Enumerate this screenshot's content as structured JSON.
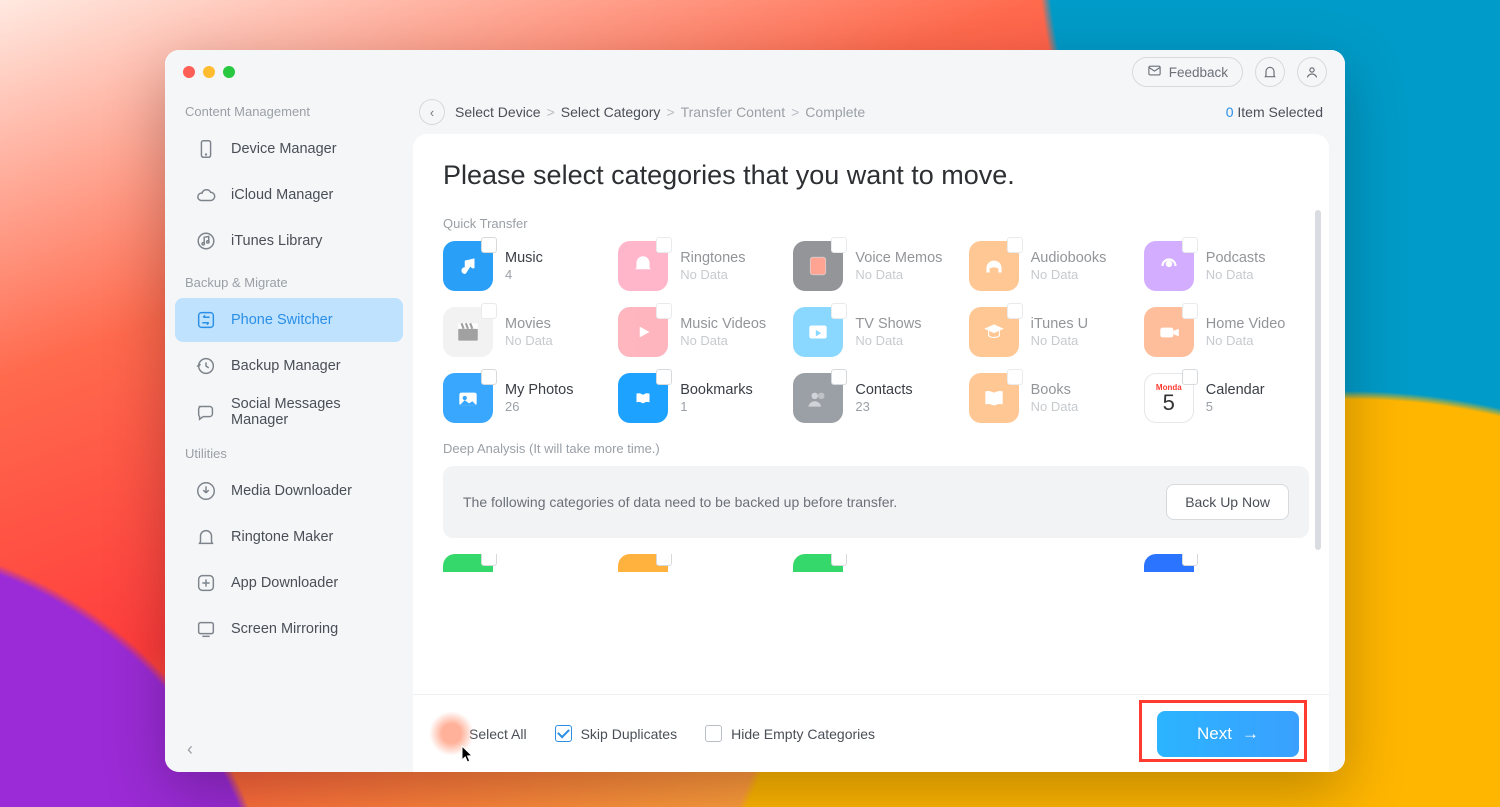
{
  "header": {
    "feedback_label": "Feedback",
    "selected_count": 0,
    "selected_label": "Item Selected"
  },
  "breadcrumb": {
    "items": [
      {
        "label": "Select Device",
        "active": true
      },
      {
        "label": "Select Category",
        "active": true
      },
      {
        "label": "Transfer Content",
        "active": false
      },
      {
        "label": "Complete",
        "active": false
      }
    ]
  },
  "sidebar": {
    "sections": [
      {
        "label": "Content Management",
        "items": [
          {
            "id": "device-manager",
            "label": "Device Manager",
            "icon": "phone"
          },
          {
            "id": "icloud-manager",
            "label": "iCloud Manager",
            "icon": "cloud"
          },
          {
            "id": "itunes-library",
            "label": "iTunes Library",
            "icon": "itunes"
          }
        ]
      },
      {
        "label": "Backup & Migrate",
        "items": [
          {
            "id": "phone-switcher",
            "label": "Phone Switcher",
            "icon": "swap",
            "active": true
          },
          {
            "id": "backup-manager",
            "label": "Backup Manager",
            "icon": "history"
          },
          {
            "id": "social-messages",
            "label": "Social Messages Manager",
            "icon": "chat"
          }
        ]
      },
      {
        "label": "Utilities",
        "items": [
          {
            "id": "media-downloader",
            "label": "Media Downloader",
            "icon": "download"
          },
          {
            "id": "ringtone-maker",
            "label": "Ringtone Maker",
            "icon": "bell"
          },
          {
            "id": "app-downloader",
            "label": "App Downloader",
            "icon": "app"
          },
          {
            "id": "screen-mirroring",
            "label": "Screen Mirroring",
            "icon": "mirror"
          }
        ]
      }
    ]
  },
  "page": {
    "title": "Please select categories that you want to move.",
    "quick_transfer_label": "Quick Transfer",
    "deep_analysis_label": "Deep Analysis (It will take more time.)",
    "banner_msg": "The following categories of data need to be backed up before transfer.",
    "backup_btn": "Back Up Now"
  },
  "categories": [
    {
      "id": "music",
      "name": "Music",
      "sub": "4",
      "color": "#2a9ff8",
      "dim": false,
      "icon": "music"
    },
    {
      "id": "ringtones",
      "name": "Ringtones",
      "sub": "No Data",
      "color": "#ff7aa0",
      "dim": true,
      "icon": "bell-fill"
    },
    {
      "id": "voice-memos",
      "name": "Voice Memos",
      "sub": "No Data",
      "color": "#3b3f46",
      "dim": true,
      "icon": "mic"
    },
    {
      "id": "audiobooks",
      "name": "Audiobooks",
      "sub": "No Data",
      "color": "#ff9a3c",
      "dim": true,
      "icon": "headphones"
    },
    {
      "id": "podcasts",
      "name": "Podcasts",
      "sub": "No Data",
      "color": "#b06bff",
      "dim": true,
      "icon": "podcast"
    },
    {
      "id": "movies",
      "name": "Movies",
      "sub": "No Data",
      "color": "#e8e8e8",
      "dim": true,
      "icon": "clapper"
    },
    {
      "id": "music-videos",
      "name": "Music Videos",
      "sub": "No Data",
      "color": "#ff7a8a",
      "dim": true,
      "icon": "play"
    },
    {
      "id": "tv-shows",
      "name": "TV Shows",
      "sub": "No Data",
      "color": "#2bb8ff",
      "dim": true,
      "icon": "tv"
    },
    {
      "id": "itunes-u",
      "name": "iTunes U",
      "sub": "No Data",
      "color": "#ff9a3c",
      "dim": true,
      "icon": "grad"
    },
    {
      "id": "home-video",
      "name": "Home Video",
      "sub": "No Data",
      "color": "#ff8a4a",
      "dim": true,
      "icon": "camcorder"
    },
    {
      "id": "my-photos",
      "name": "My Photos",
      "sub": "26",
      "color": "#3aa7ff",
      "dim": false,
      "icon": "photo"
    },
    {
      "id": "bookmarks",
      "name": "Bookmarks",
      "sub": "1",
      "color": "#1ea2ff",
      "dim": false,
      "icon": "book"
    },
    {
      "id": "contacts",
      "name": "Contacts",
      "sub": "23",
      "color": "#9aa0a6",
      "dim": false,
      "icon": "people"
    },
    {
      "id": "books",
      "name": "Books",
      "sub": "No Data",
      "color": "#ff9a3c",
      "dim": true,
      "icon": "openbook"
    },
    {
      "id": "calendar",
      "name": "Calendar",
      "sub": "5",
      "color": "#ffffff",
      "dim": false,
      "icon": "cal"
    }
  ],
  "partial_tiles": [
    "#35d96b",
    "#ffb23e",
    "#35d96b",
    "",
    "#2b74ff"
  ],
  "footer": {
    "select_all": "Select All",
    "skip_dup": "Skip Duplicates",
    "hide_empty": "Hide Empty Categories",
    "next": "Next"
  }
}
